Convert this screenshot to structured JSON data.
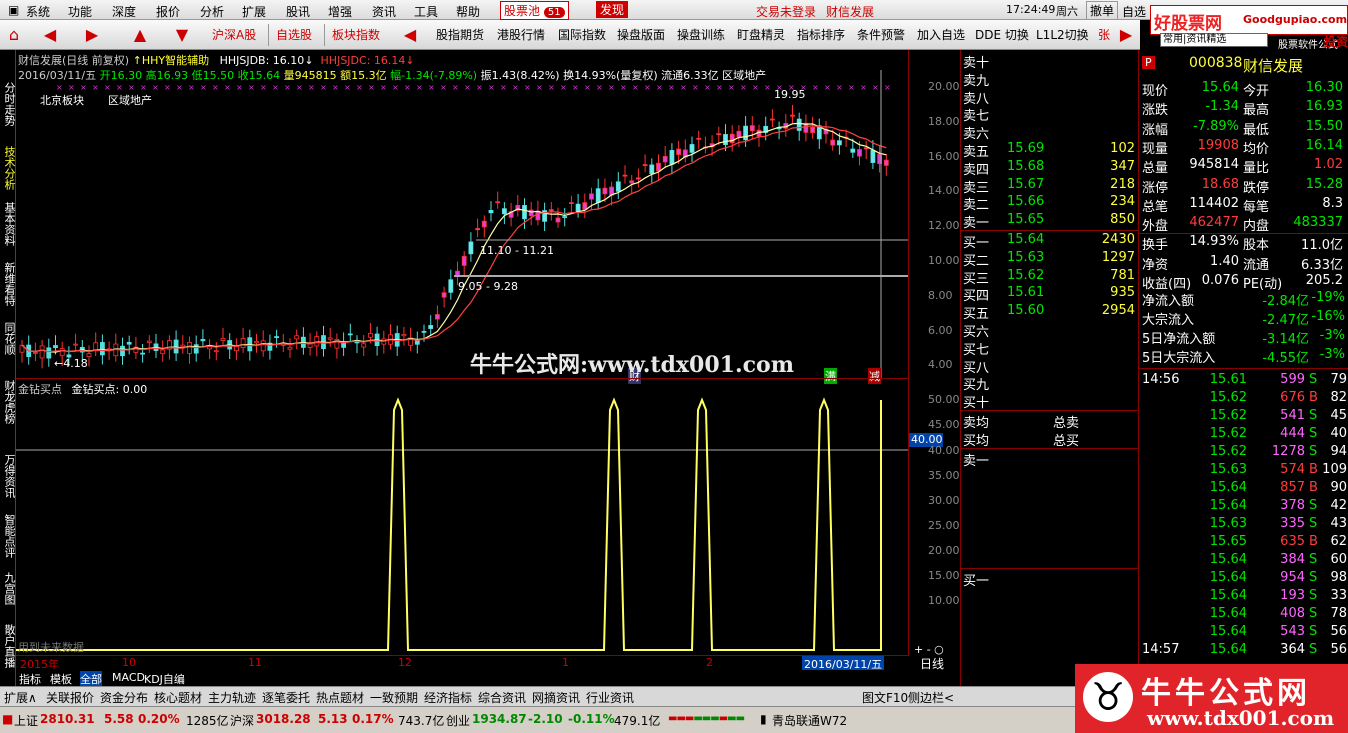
{
  "menu": [
    "系统",
    "功能",
    "深度",
    "报价",
    "分析",
    "扩展",
    "股讯",
    "增强",
    "资讯",
    "工具",
    "帮助"
  ],
  "menu_center": {
    "pool": "股票池",
    "pool_count": "51",
    "discover": "发现",
    "login_status": "交易未登录",
    "stock_name": "财信发展"
  },
  "menu_right": {
    "time": "17:24:49",
    "weekday": "周六",
    "btn1": "撤单",
    "btn2": "自选"
  },
  "brand_top": {
    "name": "好股票网",
    "url": "Goodgupiao.com",
    "sub": "股票软件公式",
    "invest": "投资"
  },
  "toolbar": [
    "沪深A股",
    "自选股",
    "板块指数",
    "股指期货",
    "港股行情",
    "国际指数",
    "操盘版面",
    "操盘训练",
    "盯盘精灵",
    "指标排序",
    "条件预警",
    "加入自选",
    "DDE 切换",
    "L1L2切换",
    "张"
  ],
  "toolbar_select": "常用|资讯精选",
  "leftnav": [
    "分时走势",
    "技术分析",
    "基本资料",
    "新维看特",
    "同花顺",
    "财龙虎榜",
    "万得资讯",
    "智能点评",
    "九宫图",
    "散户直播"
  ],
  "chart_header": {
    "title": "财信发展(日线 前复权)",
    "indicator": "HHY智能辅助",
    "hh1": "HHJSJDB: 16.10",
    "hh2": "HHJSJDC: 16.14",
    "line2_date": "2016/03/11/五",
    "line2_open": "开16.30",
    "line2_high": "高16.93",
    "line2_low": "低15.50",
    "line2_close": "收15.64",
    "line2_vol": "量945815",
    "line2_amount": "额15.3亿",
    "line2_pct": "幅-1.34(-7.89%)",
    "line2_amp": "振1.43(8.42%)",
    "line2_turn": "换14.93%(量复权)",
    "line2_float": "流通6.33亿",
    "line2_sector": "区域地产",
    "label_bj": "北京板块",
    "label_qy": "区域地产"
  },
  "chart_annotations": {
    "high_label": "19.95",
    "box1": "11.10 - 11.21",
    "box2": "9.05 - 9.28",
    "low_label": "4.18",
    "tag_cai": "财",
    "tag_man": "满",
    "tag_jian": "减"
  },
  "price_axis": [
    "20.00",
    "18.00",
    "16.00",
    "14.00",
    "12.00",
    "10.00",
    "8.00",
    "6.00",
    "4.00"
  ],
  "sub_chart": {
    "title": "金钻买点",
    "label": "金钻买点: 0.00",
    "future": "用到未来数据",
    "marker": "40.00"
  },
  "sub_axis": [
    "50.00",
    "45.00",
    "40.00",
    "35.00",
    "30.00",
    "25.00",
    "20.00",
    "15.00",
    "10.00"
  ],
  "time_axis": {
    "year": "2015年",
    "m1": "10",
    "m2": "11",
    "m3": "12",
    "m4": "1",
    "m5": "2",
    "cursor": "2016/03/11/五",
    "period": "日线"
  },
  "sub_tabs": [
    "指标",
    "模板",
    "全部",
    "MACD",
    "KDJ自编"
  ],
  "watermark": "牛牛公式网:www.tdx001.com",
  "orderbook": {
    "sells": [
      {
        "label": "卖十",
        "price": "",
        "vol": ""
      },
      {
        "label": "卖九",
        "price": "",
        "vol": ""
      },
      {
        "label": "卖八",
        "price": "",
        "vol": ""
      },
      {
        "label": "卖七",
        "price": "",
        "vol": ""
      },
      {
        "label": "卖六",
        "price": "",
        "vol": ""
      },
      {
        "label": "卖五",
        "price": "15.69",
        "vol": "102"
      },
      {
        "label": "卖四",
        "price": "15.68",
        "vol": "347"
      },
      {
        "label": "卖三",
        "price": "15.67",
        "vol": "218"
      },
      {
        "label": "卖二",
        "price": "15.66",
        "vol": "234"
      },
      {
        "label": "卖一",
        "price": "15.65",
        "vol": "850"
      }
    ],
    "buys": [
      {
        "label": "买一",
        "price": "15.64",
        "vol": "2430"
      },
      {
        "label": "买二",
        "price": "15.63",
        "vol": "1297"
      },
      {
        "label": "买三",
        "price": "15.62",
        "vol": "781"
      },
      {
        "label": "买四",
        "price": "15.61",
        "vol": "935"
      },
      {
        "label": "买五",
        "price": "15.60",
        "vol": "2954"
      },
      {
        "label": "买六",
        "price": "",
        "vol": ""
      },
      {
        "label": "买七",
        "price": "",
        "vol": ""
      },
      {
        "label": "买八",
        "price": "",
        "vol": ""
      },
      {
        "label": "买九",
        "price": "",
        "vol": ""
      },
      {
        "label": "买十",
        "price": "",
        "vol": ""
      }
    ],
    "avg_sell": "卖均",
    "total_sell": "总卖",
    "avg_buy": "买均",
    "total_buy": "总买",
    "sell1": "卖一",
    "buy1": "买一",
    "tabs": [
      "队列",
      "分布",
      "龙虎"
    ]
  },
  "quote": {
    "code": "000838",
    "name": "财信发展",
    "flag": "P",
    "rows": [
      {
        "l": "现价",
        "v": "15.64",
        "c": "green",
        "l2": "今开",
        "v2": "16.30",
        "c2": "green"
      },
      {
        "l": "涨跌",
        "v": "-1.34",
        "c": "green",
        "l2": "最高",
        "v2": "16.93",
        "c2": "green"
      },
      {
        "l": "涨幅",
        "v": "-7.89%",
        "c": "green",
        "l2": "最低",
        "v2": "15.50",
        "c2": "green"
      },
      {
        "l": "现量",
        "v": "19908",
        "c": "red",
        "l2": "均价",
        "v2": "16.14",
        "c2": "green"
      },
      {
        "l": "总量",
        "v": "945814",
        "c": "white",
        "l2": "量比",
        "v2": "1.02",
        "c2": "red"
      },
      {
        "l": "涨停",
        "v": "18.68",
        "c": "red",
        "l2": "跌停",
        "v2": "15.28",
        "c2": "green"
      },
      {
        "l": "总笔",
        "v": "114402",
        "c": "white",
        "l2": "每笔",
        "v2": "8.3",
        "c2": "white"
      },
      {
        "l": "外盘",
        "v": "462477",
        "c": "red",
        "l2": "内盘",
        "v2": "483337",
        "c2": "green"
      },
      {
        "l": "换手",
        "v": "14.93%",
        "c": "white",
        "l2": "股本",
        "v2": "11.0亿",
        "c2": "white"
      },
      {
        "l": "净资",
        "v": "1.40",
        "c": "white",
        "l2": "流通",
        "v2": "6.33亿",
        "c2": "white"
      },
      {
        "l": "收益(四)",
        "v": "0.076",
        "c": "white",
        "l2": "PE(动)",
        "v2": "205.2",
        "c2": "white"
      }
    ],
    "flows": [
      {
        "l": "净流入额",
        "v": "-2.84亿",
        "p": "-19%"
      },
      {
        "l": "大宗流入",
        "v": "-2.47亿",
        "p": "-16%"
      },
      {
        "l": "5日净流入额",
        "v": "-3.14亿",
        "p": "-3%"
      },
      {
        "l": "5日大宗流入",
        "v": "-4.55亿",
        "p": "-3%"
      }
    ],
    "ticks_time": "14:56",
    "ticks": [
      {
        "p": "15.61",
        "v": "599",
        "s": "S",
        "n": "79"
      },
      {
        "p": "15.62",
        "v": "676",
        "s": "B",
        "n": "82"
      },
      {
        "p": "15.62",
        "v": "541",
        "s": "S",
        "n": "45"
      },
      {
        "p": "15.62",
        "v": "444",
        "s": "S",
        "n": "40"
      },
      {
        "p": "15.62",
        "v": "1278",
        "s": "S",
        "n": "94"
      },
      {
        "p": "15.63",
        "v": "574",
        "s": "B",
        "n": "109"
      },
      {
        "p": "15.64",
        "v": "857",
        "s": "B",
        "n": "90"
      },
      {
        "p": "15.64",
        "v": "378",
        "s": "S",
        "n": "42"
      },
      {
        "p": "15.63",
        "v": "335",
        "s": "S",
        "n": "43"
      },
      {
        "p": "15.65",
        "v": "635",
        "s": "B",
        "n": "62"
      },
      {
        "p": "15.64",
        "v": "384",
        "s": "S",
        "n": "60"
      },
      {
        "p": "15.64",
        "v": "954",
        "s": "S",
        "n": "98"
      },
      {
        "p": "15.64",
        "v": "193",
        "s": "S",
        "n": "33"
      },
      {
        "p": "15.64",
        "v": "408",
        "s": "S",
        "n": "78"
      },
      {
        "p": "15.64",
        "v": "543",
        "s": "S",
        "n": "56"
      }
    ],
    "last_time": "14:57",
    "last_p": "15.64",
    "last_v": "364",
    "last_s": "S",
    "last_n": "56"
  },
  "bottom_tabs": [
    "扩展∧",
    "关联报价",
    "资金分布",
    "核心题材",
    "主力轨迹",
    "逐笔委托",
    "热点题材",
    "一致预期",
    "经济指标",
    "综合资讯",
    "网摘资讯",
    "行业资讯"
  ],
  "bottom_right": {
    "f10": "图文F10",
    "side": "侧边栏<"
  },
  "status": {
    "sh_label": "上证",
    "sh_val": "2810.31",
    "sh_chg": "5.58",
    "sh_pct": "0.20%",
    "sh_amt": "1285亿",
    "sz_label": "沪深",
    "sz_val": "3018.28",
    "sz_chg": "5.13",
    "sz_pct": "0.17%",
    "sz_amt": "743.7亿",
    "cy_label": "创业",
    "cy_val": "1934.87",
    "cy_chg": "-2.10",
    "cy_pct": "-0.11%",
    "cy_amt": "479.1亿",
    "server": "青岛联通W72"
  },
  "brand_bottom": {
    "name": "牛牛公式网",
    "url": "www.tdx001.com"
  }
}
